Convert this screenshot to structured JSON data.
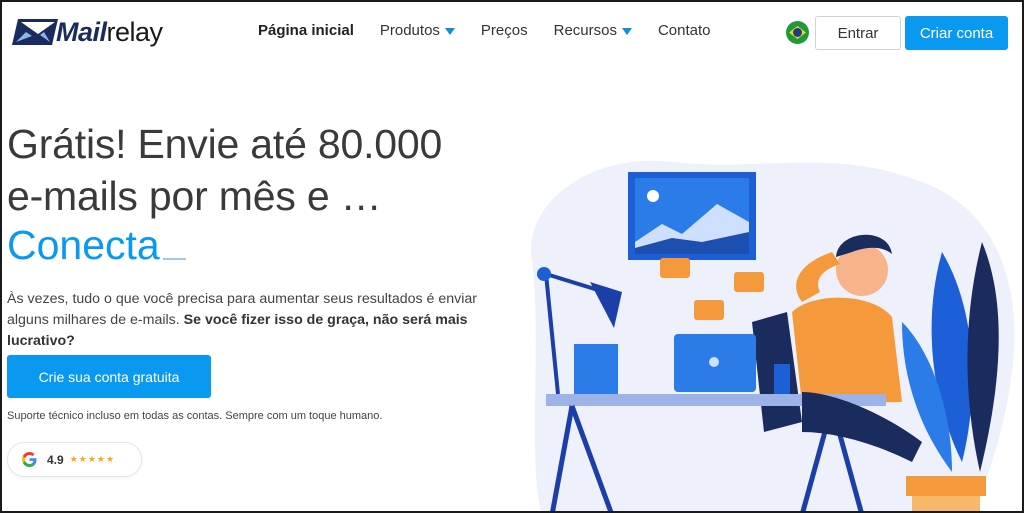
{
  "brand": {
    "logo_bold": "Mail",
    "logo_rest": "relay"
  },
  "nav": {
    "items": [
      {
        "label": "Página inicial",
        "active": true,
        "dropdown": false
      },
      {
        "label": "Produtos",
        "active": false,
        "dropdown": true
      },
      {
        "label": "Preços",
        "active": false,
        "dropdown": false
      },
      {
        "label": "Recursos",
        "active": false,
        "dropdown": true
      },
      {
        "label": "Contato",
        "active": false,
        "dropdown": false
      }
    ],
    "language_flag": "brazil-flag-icon",
    "login_label": "Entrar",
    "signup_label": "Criar conta"
  },
  "hero": {
    "headline_line1": "Grátis! Envie até 80.000",
    "headline_line2": "e-mails por mês e …",
    "typed_word": "Conecta",
    "description_plain": "Às vezes, tudo o que você precisa para aumentar seus resultados é enviar alguns milhares de e-mails.",
    "description_bold": "Se você fizer isso de graça, não será mais lucrativo?",
    "cta_label": "Crie sua conta gratuita",
    "support_text": "Suporte técnico incluso em todas as contas. Sempre com um toque humano.",
    "rating_value": "4.9",
    "rating_stars": 5
  },
  "colors": {
    "accent": "#0a99f0",
    "text": "#3a3a3a",
    "brand_dark": "#1a2b5e",
    "orange": "#f59a3c"
  }
}
